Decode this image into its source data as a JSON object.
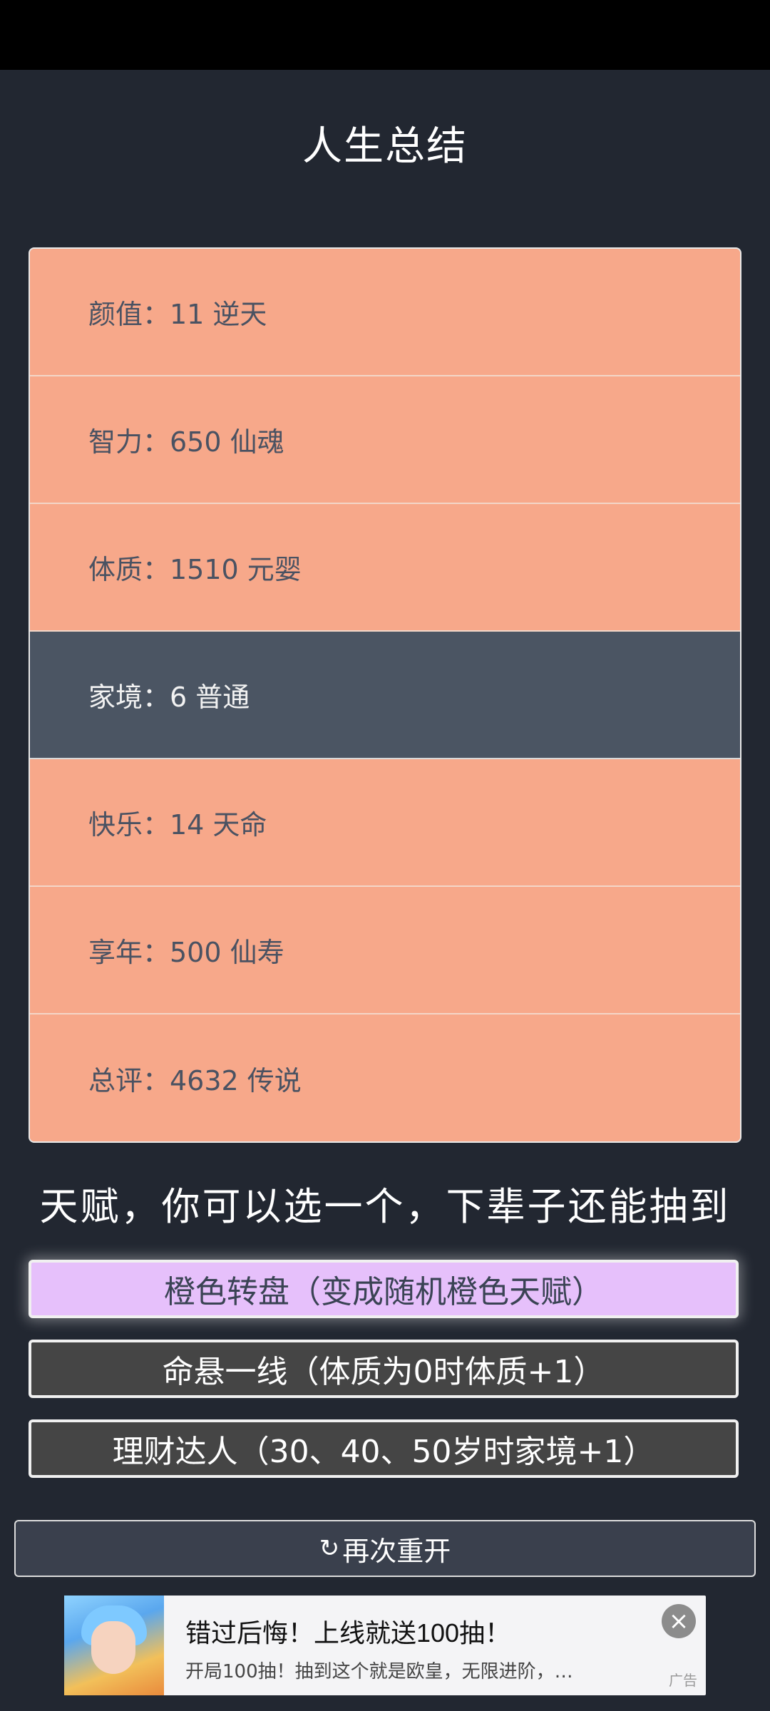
{
  "title": "人生总结",
  "stats": [
    {
      "label": "颜值：11 逆天",
      "highlight": false
    },
    {
      "label": "智力：650 仙魂",
      "highlight": false
    },
    {
      "label": "体质：1510 元婴",
      "highlight": false
    },
    {
      "label": "家境：6 普通",
      "highlight": true
    },
    {
      "label": "快乐：14 天命",
      "highlight": false
    },
    {
      "label": "享年：500 仙寿",
      "highlight": false
    },
    {
      "label": "总评：4632 传说",
      "highlight": false
    }
  ],
  "talent_header": "天赋，你可以选一个，下辈子还能抽到",
  "talents": [
    {
      "label": "橙色转盘（变成随机橙色天赋）",
      "selected": true
    },
    {
      "label": "命悬一线（体质为0时体质+1）",
      "selected": false
    },
    {
      "label": "理财达人（30、40、50岁时家境+1）",
      "selected": false
    }
  ],
  "restart": {
    "icon": "refresh-icon",
    "label": "再次重开"
  },
  "ad": {
    "title": "错过后悔！上线就送100抽！",
    "description": "开局100抽！抽到这个就是欧皇，无限进阶，…",
    "label": "广告",
    "close_icon": "close-icon"
  },
  "colors": {
    "background": "#222731",
    "stat_row": "#f7a88a",
    "stat_row_highlight": "#4b5563",
    "talent_selected": "#e6c0fb",
    "talent_default": "#454545"
  }
}
